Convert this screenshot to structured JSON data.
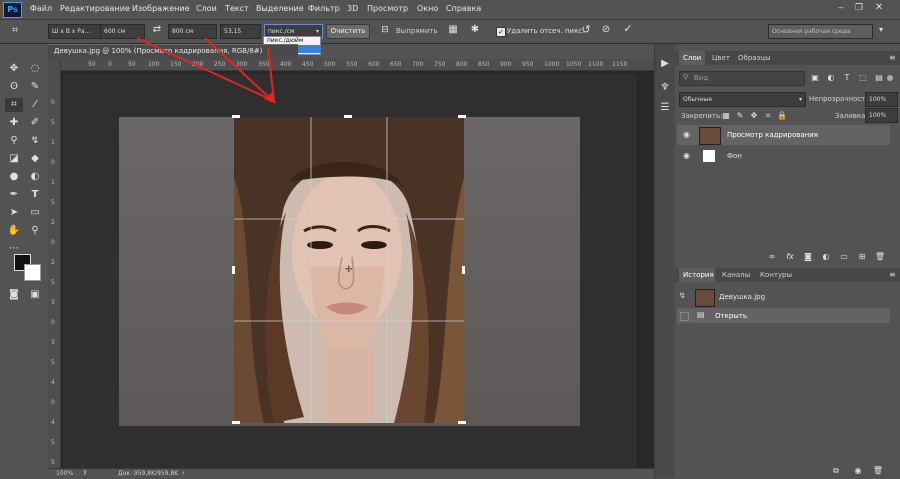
{
  "app": {
    "logo": "Ps"
  },
  "menu": [
    "Файл",
    "Редактирование",
    "Изображение",
    "Слои",
    "Текст",
    "Выделение",
    "Фильтр",
    "3D",
    "Просмотр",
    "Окно",
    "Справка"
  ],
  "options": {
    "ratio_label": "Ш x В x Ра...",
    "width_value": "600 см",
    "height_value": "800 см",
    "resolution_value": "53,15",
    "unit_selected": "пикс./см",
    "unit_options": [
      "пикс./дюйм",
      "пикс./см"
    ],
    "clear_label": "Очистить",
    "straighten_label": "Выпрямить",
    "delete_cropped_label": "Удалить отсеч. пикс.",
    "workspace_label": "Основная рабочая среда"
  },
  "document": {
    "tab_label": "Девушка.jpg @ 100% (Просмотр кадрирования, RGB/8#)",
    "ruler_top_ticks": [
      "50",
      "0",
      "50",
      "100",
      "150",
      "200",
      "250",
      "300",
      "350",
      "400",
      "450",
      "500",
      "550",
      "600",
      "650",
      "700",
      "750",
      "800",
      "850",
      "900",
      "950",
      "1000",
      "1050",
      "1100",
      "1150"
    ],
    "ruler_left_ticks": [
      "0",
      "5",
      "1",
      "0",
      "1",
      "5",
      "2",
      "0",
      "2",
      "5",
      "3",
      "0",
      "3",
      "5",
      "4",
      "0",
      "4",
      "5",
      "5",
      "0"
    ]
  },
  "status": {
    "zoom": "100%",
    "doc_info": "Док: 959,8K/959,8K"
  },
  "layers_panel": {
    "tabs": [
      "Слои",
      "Цвет",
      "Образцы"
    ],
    "search_placeholder": "Вид",
    "blend_mode": "Обычные",
    "opacity_label": "Непрозрачность:",
    "opacity_value": "100%",
    "lock_label": "Закрепить:",
    "fill_label": "Заливка:",
    "fill_value": "100%",
    "layers": [
      {
        "name": "Просмотр кадрирования",
        "selected": true
      },
      {
        "name": "Фон",
        "selected": false
      }
    ]
  },
  "history_panel": {
    "tabs": [
      "История",
      "Каналы",
      "Контуры"
    ],
    "snapshot": "Девушка.jpg",
    "items": [
      "Открыть"
    ]
  },
  "colors": {
    "accent": "#3aa0ff",
    "arrow": "#e02424",
    "selection": "#636363"
  }
}
